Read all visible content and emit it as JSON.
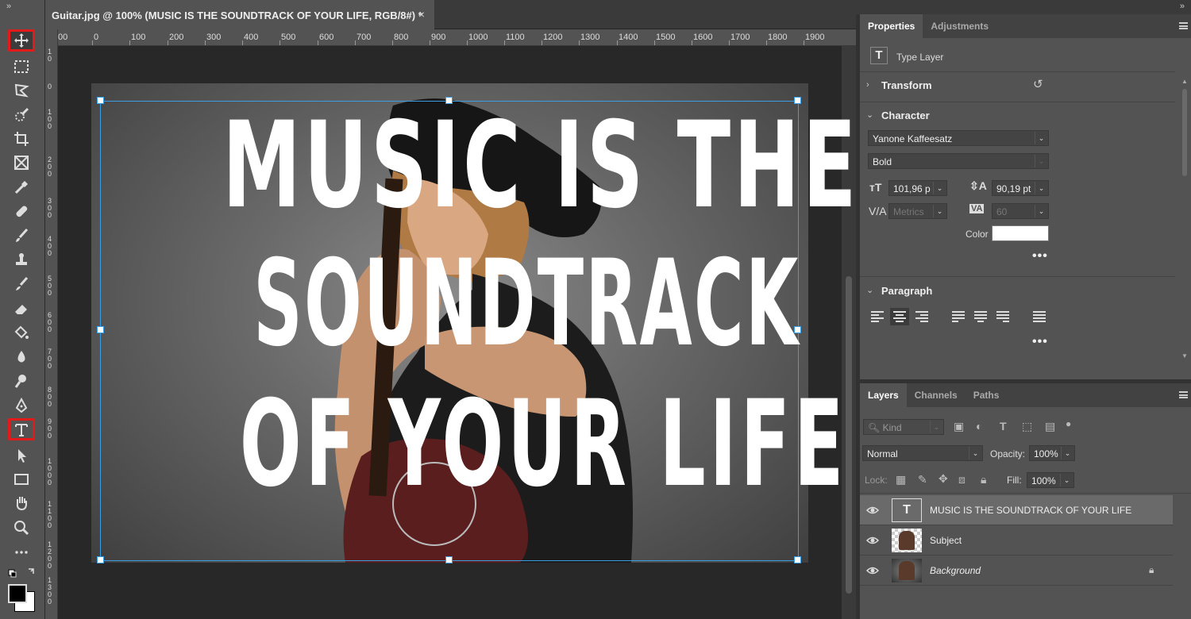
{
  "toolbar": {
    "collapse": "»",
    "tools": [
      "move-tool",
      "marquee-tool",
      "lasso-tool",
      "quick-select-tool",
      "crop-tool",
      "frame-tool",
      "eyedropper-tool",
      "healing-tool",
      "brush-tool",
      "stamp-tool",
      "history-brush-tool",
      "eraser-tool",
      "paint-bucket-tool",
      "blur-tool",
      "dodge-tool",
      "pen-tool",
      "type-tool",
      "path-select-tool",
      "rectangle-tool",
      "hand-tool",
      "zoom-tool",
      "more-tools"
    ],
    "highlighted": [
      "move-tool",
      "type-tool"
    ]
  },
  "document": {
    "tab_title": "Guitar.jpg @ 100% (MUSIC IS THE SOUNDTRACK OF YOUR LIFE, RGB/8#) *",
    "close": "×"
  },
  "ruler": {
    "h_ticks": [
      "00",
      "0",
      "100",
      "200",
      "300",
      "400",
      "500",
      "600",
      "700",
      "800",
      "900",
      "1000",
      "1100",
      "1200",
      "1300",
      "1400",
      "1500",
      "1600",
      "1700",
      "1800",
      "1900"
    ],
    "v_ticks": [
      "1 0",
      "0",
      "1 0 0",
      "2 0 0",
      "3 0 0",
      "4 0 0",
      "5 0 0",
      "6 0 0",
      "7 0 0",
      "8 0 0",
      "9 0 0",
      "1 0 0 0",
      "1 1 0 0",
      "1 2 0 0",
      "1 3 0 0"
    ]
  },
  "canvas": {
    "lines": [
      "MUSIC IS THE",
      "SOUNDTRACK",
      "OF YOUR LIFE"
    ]
  },
  "properties": {
    "tabs": [
      "Properties",
      "Adjustments"
    ],
    "layer_type": "Type Layer",
    "transform": "Transform",
    "character": "Character",
    "font_family": "Yanone Kaffeesatz",
    "font_style": "Bold",
    "font_size": "101,96 p",
    "leading": "90,19 pt",
    "kerning": "Metrics",
    "tracking": "60",
    "color_label": "Color",
    "color_value": "#ffffff",
    "paragraph": "Paragraph",
    "more": "•••"
  },
  "layers_panel": {
    "tabs": [
      "Layers",
      "Channels",
      "Paths"
    ],
    "kind": "Kind",
    "blend_mode": "Normal",
    "opacity_label": "Opacity:",
    "opacity": "100%",
    "lock_label": "Lock:",
    "fill_label": "Fill:",
    "fill": "100%",
    "layers": [
      {
        "name": "MUSIC IS THE SOUNDTRACK OF YOUR LIFE",
        "selected": true
      },
      {
        "name": "Subject",
        "selected": false
      },
      {
        "name": "Background",
        "selected": false
      }
    ]
  }
}
